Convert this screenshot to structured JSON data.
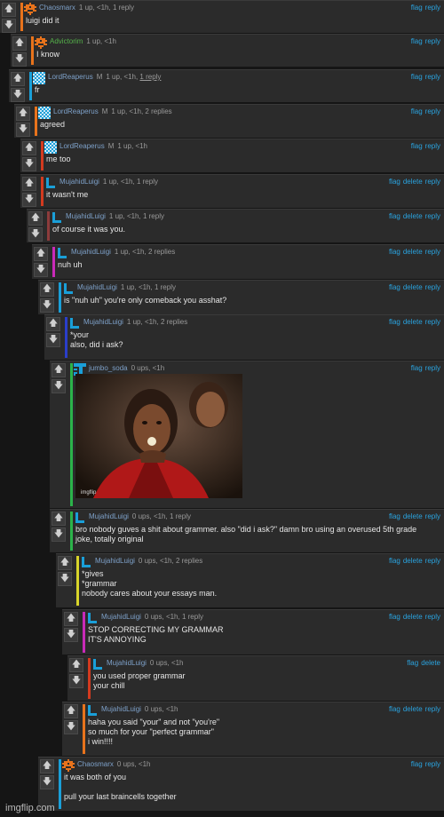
{
  "colors": {
    "background": "#151515",
    "panel": "#2b2b2b",
    "link": "#2aa3df",
    "username": "#7da0c8",
    "meta": "#9a9a9a"
  },
  "icons": {
    "upvote": "up-arrow-icon",
    "downvote": "down-arrow-icon"
  },
  "comments": [
    {
      "user": "Chaosmarx",
      "badge": "",
      "meta": "1 up, <1h, 1 reply",
      "meta_u": "",
      "actions": [
        "flag",
        "reply"
      ],
      "text": "luigi did it",
      "bar": "#e8731c",
      "avatar": "pixel-orange",
      "ucolor": "#7da0c8"
    },
    {
      "user": "Advictorim",
      "badge": "",
      "meta": "1 up, <1h",
      "meta_u": "",
      "actions": [
        "flag",
        "reply"
      ],
      "text": "I know",
      "bar": "#e8731c",
      "avatar": "pixel-orange",
      "ucolor": "#55b24a"
    },
    {
      "user": "LordReaperus",
      "badge": "M",
      "meta": "1 up, <1h,",
      "meta_u": "1 reply",
      "actions": [
        "flag",
        "reply"
      ],
      "text": "fr",
      "bar": "#1a9fd8",
      "avatar": "checker-blue",
      "ucolor": "#7da0c8"
    },
    {
      "user": "LordReaperus",
      "badge": "M",
      "meta": "1 up, <1h, 2 replies",
      "meta_u": "",
      "actions": [
        "flag",
        "reply"
      ],
      "text": "agreed",
      "bar": "#e8731c",
      "avatar": "checker-blue",
      "ucolor": "#7da0c8"
    },
    {
      "user": "LordReaperus",
      "badge": "M",
      "meta": "1 up, <1h",
      "meta_u": "",
      "actions": [
        "flag",
        "reply"
      ],
      "text": "me too",
      "bar": "#d33a1f",
      "avatar": "checker-blue",
      "ucolor": "#7da0c8"
    },
    {
      "user": "MujahidLuigi",
      "badge": "",
      "meta": "1 up, <1h, 1 reply",
      "meta_u": "",
      "actions": [
        "flag",
        "delete",
        "reply"
      ],
      "text": "it wasn't me",
      "bar": "#d33a1f",
      "avatar": "letter-l",
      "ucolor": "#7da0c8"
    },
    {
      "user": "MujahidLuigi",
      "badge": "",
      "meta": "1 up, <1h, 1 reply",
      "meta_u": "",
      "actions": [
        "flag",
        "delete",
        "reply"
      ],
      "text": "of course it was you.",
      "bar": "#8c3b3b",
      "avatar": "letter-l",
      "ucolor": "#7da0c8"
    },
    {
      "user": "MujahidLuigi",
      "badge": "",
      "meta": "1 up, <1h, 2 replies",
      "meta_u": "",
      "actions": [
        "flag",
        "delete",
        "reply"
      ],
      "text": "nuh uh",
      "bar": "#c92ab8",
      "avatar": "letter-l",
      "ucolor": "#7da0c8"
    },
    {
      "user": "MujahidLuigi",
      "badge": "",
      "meta": "1 up, <1h, 1 reply",
      "meta_u": "",
      "actions": [
        "flag",
        "delete",
        "reply"
      ],
      "text": "is \"nuh uh\" you're only comeback you asshat?",
      "bar": "#1a9fd8",
      "avatar": "letter-l",
      "ucolor": "#7da0c8"
    },
    {
      "user": "MujahidLuigi",
      "badge": "",
      "meta": "1 up, <1h, 2 replies",
      "meta_u": "",
      "actions": [
        "flag",
        "delete",
        "reply"
      ],
      "text": "*your\nalso, did i ask?",
      "bar": "#2a3ec9",
      "avatar": "letter-l",
      "ucolor": "#7da0c8"
    },
    {
      "user": "jumbo_soda",
      "badge": "",
      "meta": "0 ups, <1h",
      "meta_u": "",
      "actions": [
        "flag",
        "reply"
      ],
      "text": "",
      "bar": "#2bb34a",
      "avatar": "grid-blue",
      "ucolor": "#7da0c8",
      "image": "michael-jackson-popcorn"
    },
    {
      "user": "MujahidLuigi",
      "badge": "",
      "meta": "0 ups, <1h, 1 reply",
      "meta_u": "",
      "actions": [
        "flag",
        "delete",
        "reply"
      ],
      "text": "bro nobody guves a shit about grammer. also \"did i ask?\" damn bro using an overused 5th grade\njoke, totally original",
      "bar": "#2bb34a",
      "avatar": "letter-l",
      "ucolor": "#7da0c8"
    },
    {
      "user": "MujahidLuigi",
      "badge": "",
      "meta": "0 ups, <1h, 2 replies",
      "meta_u": "",
      "actions": [
        "flag",
        "delete",
        "reply"
      ],
      "text": "*gives\n*grammar\nnobody cares about your essays man.",
      "bar": "#d8d42a",
      "avatar": "letter-l",
      "ucolor": "#7da0c8"
    },
    {
      "user": "MujahidLuigi",
      "badge": "",
      "meta": "0 ups, <1h, 1 reply",
      "meta_u": "",
      "actions": [
        "flag",
        "delete",
        "reply"
      ],
      "text": "STOP CORRECTING MY GRAMMAR\nIT'S ANNOYING",
      "bar": "#c92ab8",
      "avatar": "letter-l",
      "ucolor": "#7da0c8"
    },
    {
      "user": "MujahidLuigi",
      "badge": "",
      "meta": "0 ups, <1h",
      "meta_u": "",
      "actions": [
        "flag",
        "delete"
      ],
      "text": "you used proper grammar\nyour chill",
      "bar": "#d33a1f",
      "avatar": "letter-l",
      "ucolor": "#7da0c8"
    },
    {
      "user": "MujahidLuigi",
      "badge": "",
      "meta": "0 ups, <1h",
      "meta_u": "",
      "actions": [
        "flag",
        "delete",
        "reply"
      ],
      "text": "haha you said \"your\" and not \"you're\"\nso much for your \"perfect grammar\"\ni win!!!!",
      "bar": "#e8731c",
      "avatar": "letter-l",
      "ucolor": "#7da0c8"
    },
    {
      "user": "Chaosmarx",
      "badge": "",
      "meta": "0 ups, <1h",
      "meta_u": "",
      "actions": [
        "flag",
        "reply"
      ],
      "text": "it was both of you\n\npull your last braincells together",
      "bar": "#1a9fd8",
      "avatar": "pixel-orange",
      "ucolor": "#7da0c8"
    }
  ],
  "watermark": "imgflip.com"
}
